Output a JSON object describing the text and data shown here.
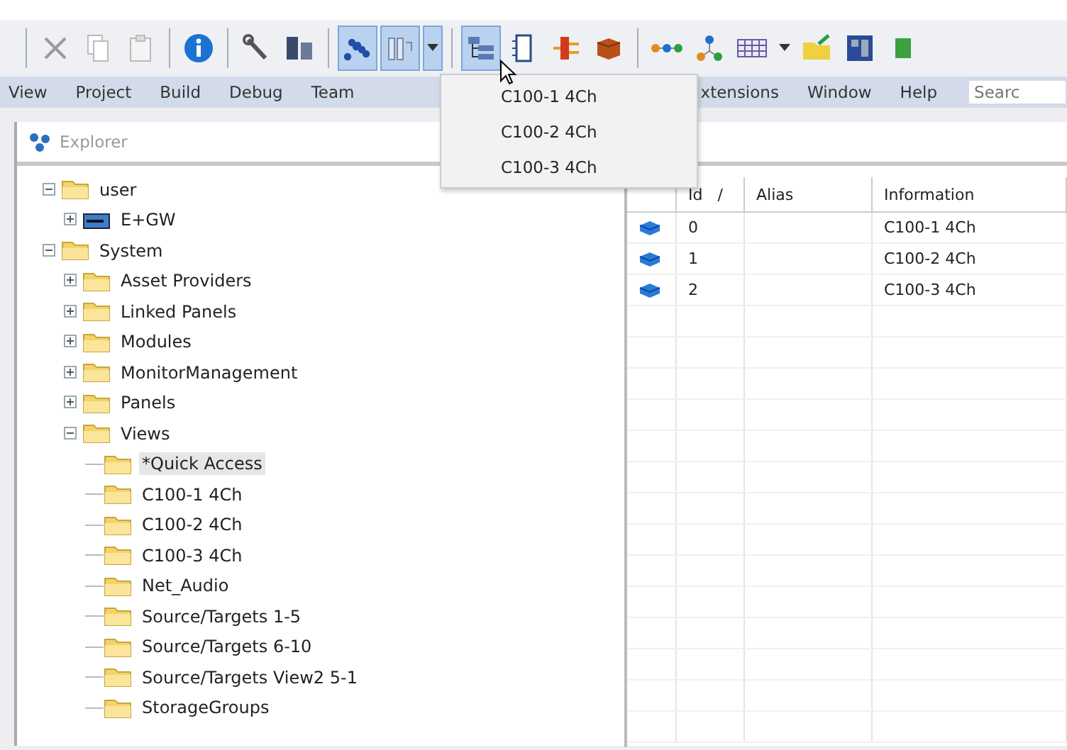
{
  "toolbar": [
    {
      "kind": "separator"
    },
    {
      "kind": "cut",
      "pressed": false
    },
    {
      "kind": "copy",
      "pressed": false
    },
    {
      "kind": "paste",
      "pressed": false
    },
    {
      "kind": "separator"
    },
    {
      "kind": "info",
      "pressed": false
    },
    {
      "kind": "separator"
    },
    {
      "kind": "wrench",
      "pressed": false
    },
    {
      "kind": "device",
      "pressed": false
    },
    {
      "kind": "separator"
    },
    {
      "kind": "dots",
      "pressed": true
    },
    {
      "kind": "columns",
      "pressed": true
    },
    {
      "kind": "caret",
      "pressed": true
    },
    {
      "kind": "separator"
    },
    {
      "kind": "tree",
      "pressed": true
    },
    {
      "kind": "doc",
      "pressed": false
    },
    {
      "kind": "plug",
      "pressed": false
    },
    {
      "kind": "box",
      "pressed": false
    },
    {
      "kind": "separator"
    },
    {
      "kind": "chain",
      "pressed": false
    },
    {
      "kind": "hierarchy",
      "pressed": false
    },
    {
      "kind": "grid",
      "pressed": false
    },
    {
      "kind": "caret",
      "pressed": false
    },
    {
      "kind": "folder",
      "pressed": false
    },
    {
      "kind": "panel",
      "pressed": false
    },
    {
      "kind": "green",
      "pressed": false
    }
  ],
  "menu": [
    "View",
    "Project",
    "Build",
    "Debug",
    "Team"
  ],
  "menu_right": [
    "xtensions",
    "Window",
    "Help"
  ],
  "search": {
    "placeholder": "Searc"
  },
  "dropdown": [
    "C100-1 4Ch",
    "C100-2 4Ch",
    "C100-3 4Ch"
  ],
  "explorer": {
    "title": "Explorer"
  },
  "tree": [
    {
      "label": "user",
      "kind": "folder",
      "expanded": true,
      "selected": false,
      "children": [
        {
          "label": "E+GW",
          "kind": "device",
          "expanded": false,
          "selected": false
        }
      ]
    },
    {
      "label": "System",
      "kind": "folder",
      "expanded": true,
      "selected": false,
      "children": [
        {
          "label": "Asset Providers",
          "kind": "folder",
          "expanded": false,
          "selected": false
        },
        {
          "label": "Linked Panels",
          "kind": "folder",
          "expanded": false,
          "selected": false
        },
        {
          "label": "Modules",
          "kind": "folder",
          "expanded": false,
          "selected": false
        },
        {
          "label": "MonitorManagement",
          "kind": "folder",
          "expanded": false,
          "selected": false
        },
        {
          "label": "Panels",
          "kind": "folder",
          "expanded": false,
          "selected": false
        },
        {
          "label": "Views",
          "kind": "folder",
          "expanded": true,
          "selected": false,
          "children": [
            {
              "label": "*Quick Access",
              "kind": "folder",
              "selected": true
            },
            {
              "label": "C100-1 4Ch",
              "kind": "folder",
              "selected": false
            },
            {
              "label": "C100-2 4Ch",
              "kind": "folder",
              "selected": false
            },
            {
              "label": "C100-3 4Ch",
              "kind": "folder",
              "selected": false
            },
            {
              "label": "Net_Audio",
              "kind": "folder",
              "selected": false
            },
            {
              "label": "Source/Targets 1-5",
              "kind": "folder",
              "selected": false
            },
            {
              "label": "Source/Targets 6-10",
              "kind": "folder",
              "selected": false
            },
            {
              "label": "Source/Targets View2 5-1",
              "kind": "folder",
              "selected": false
            },
            {
              "label": "StorageGroups",
              "kind": "folder",
              "selected": false
            }
          ]
        }
      ]
    }
  ],
  "table": {
    "columns": [
      {
        "label": "Id",
        "sort": "/"
      },
      {
        "label": "Alias"
      },
      {
        "label": "Information"
      }
    ],
    "rows": [
      {
        "id": "0",
        "information": "C100-1 4Ch"
      },
      {
        "id": "1",
        "information": "C100-2 4Ch"
      },
      {
        "id": "2",
        "information": "C100-3 4Ch"
      }
    ]
  }
}
